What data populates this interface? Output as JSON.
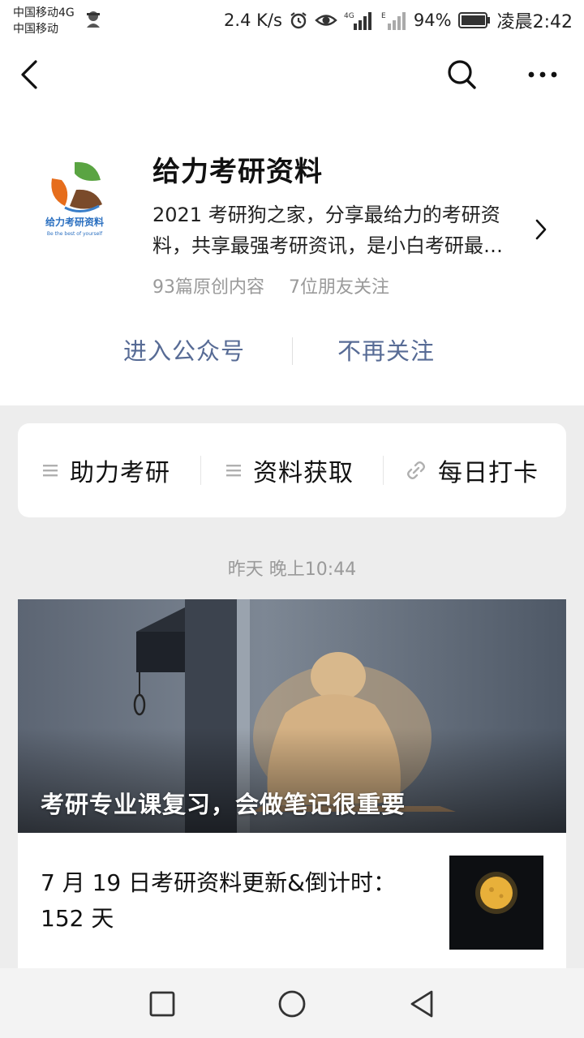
{
  "status_bar": {
    "carrier_line1": "中国移动4G",
    "carrier_line2": "中国移动",
    "net_speed": "2.4 K/s",
    "battery": "94%",
    "time": "凌晨2:42",
    "icons": [
      "alarm-icon",
      "eye-icon",
      "signal-4g-icon",
      "signal-e-icon",
      "battery-icon"
    ]
  },
  "nav": {
    "icons": [
      "back-icon",
      "search-icon",
      "more-icon"
    ]
  },
  "account": {
    "name": "给力考研资料",
    "description": "2021 考研狗之家，分享最给力的考研资料，共享最强考研资讯，是小白考研最…",
    "original_count": "93篇原创内容",
    "friends_following": "7位朋友关注",
    "enter_label": "进入公众号",
    "unfollow_label": "不再关注",
    "logo_text": "给力考研资料",
    "logo_slogan": "Be the best of yourself"
  },
  "menu": {
    "items": [
      {
        "label": "助力考研",
        "icon": "list-icon"
      },
      {
        "label": "资料获取",
        "icon": "list-icon"
      },
      {
        "label": "每日打卡",
        "icon": "link-icon"
      }
    ]
  },
  "feed": {
    "timestamp": "昨天 晚上10:44",
    "main_article_title": "考研专业课复习，会做笔记很重要",
    "sub_article_title": "7 月 19 日考研资料更新&倒计时：152 天"
  },
  "colors": {
    "link": "#576b95",
    "muted": "#9a9a9a",
    "background": "#ededed"
  }
}
